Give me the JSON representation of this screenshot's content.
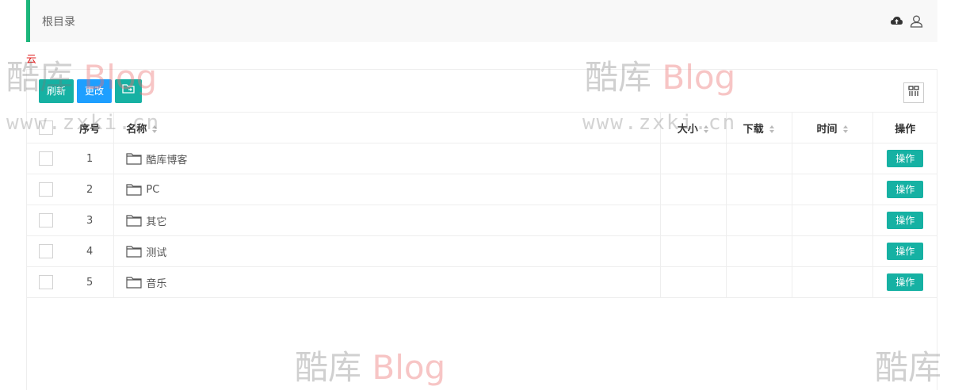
{
  "breadcrumb": {
    "root": "根目录"
  },
  "topbar_icons": [
    "cloud-upload-icon",
    "user-icon"
  ],
  "red_label": "云",
  "toolbar": {
    "refresh_label": "刷新",
    "change_label": "更改",
    "new_folder_icon": "folder-move-icon"
  },
  "table": {
    "headers": {
      "no": "序号",
      "name": "名称",
      "size": "大小",
      "download": "下载",
      "time": "时间",
      "op": "操作"
    },
    "rows": [
      {
        "no": "1",
        "name": "酷库博客",
        "size": "",
        "download": "",
        "time": "",
        "op": "操作"
      },
      {
        "no": "2",
        "name": "PC",
        "size": "",
        "download": "",
        "time": "",
        "op": "操作"
      },
      {
        "no": "3",
        "name": "其它",
        "size": "",
        "download": "",
        "time": "",
        "op": "操作"
      },
      {
        "no": "4",
        "name": "测试",
        "size": "",
        "download": "",
        "time": "",
        "op": "操作"
      },
      {
        "no": "5",
        "name": "音乐",
        "size": "",
        "download": "",
        "time": "",
        "op": "操作"
      }
    ]
  },
  "watermark": {
    "brand_cn": "酷库",
    "brand_en": "Blog",
    "url": "www.zxki.cn"
  },
  "colors": {
    "accent_green": "#1cb57b",
    "button_teal": "#16b1a3",
    "button_blue": "#1e9fff"
  }
}
